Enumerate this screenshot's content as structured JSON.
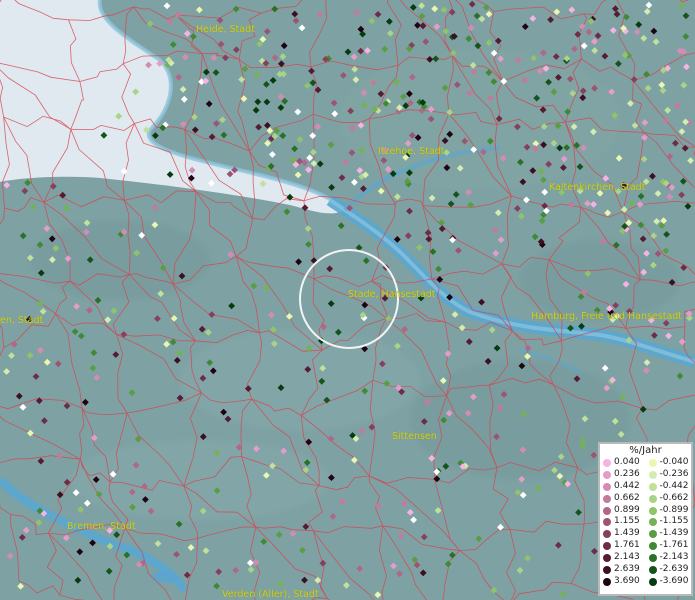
{
  "map": {
    "places": [
      {
        "name": "Heide, Stadt"
      },
      {
        "name": "Itzehoe, Stadt"
      },
      {
        "name": "Kaltenkirchen, Stadt"
      },
      {
        "name": "Stade, Hansestadt"
      },
      {
        "name": "Hamburg, Freie und Hansestadt"
      },
      {
        "name": "en, Stadt"
      },
      {
        "name": "Sittensen"
      },
      {
        "name": "Bremen, Stadt"
      },
      {
        "name": "Verden (Aller), Stadt"
      }
    ]
  },
  "legend": {
    "title": "%/Jahr",
    "rows": [
      {
        "pos": "0.040",
        "neg": "-0.040",
        "pos_color": "#f7b2e4",
        "neg_color": "#e9f7b0"
      },
      {
        "pos": "0.236",
        "neg": "-0.236",
        "pos_color": "#e59ccb",
        "neg_color": "#d3ecb0"
      },
      {
        "pos": "0.442",
        "neg": "-0.442",
        "pos_color": "#d58cb4",
        "neg_color": "#bfe19a"
      },
      {
        "pos": "0.662",
        "neg": "-0.662",
        "pos_color": "#c27a9d",
        "neg_color": "#a9d486"
      },
      {
        "pos": "0.899",
        "neg": "-0.899",
        "pos_color": "#b06888",
        "neg_color": "#8fc46b"
      },
      {
        "pos": "1.155",
        "neg": "-1.155",
        "pos_color": "#9c5473",
        "neg_color": "#74b256"
      },
      {
        "pos": "1.439",
        "neg": "-1.439",
        "pos_color": "#86405d",
        "neg_color": "#5a9e44"
      },
      {
        "pos": "1.761",
        "neg": "-1.761",
        "pos_color": "#6e2c47",
        "neg_color": "#3f8a34"
      },
      {
        "pos": "2.143",
        "neg": "-2.143",
        "pos_color": "#561c33",
        "neg_color": "#2a7026"
      },
      {
        "pos": "2.639",
        "neg": "-2.639",
        "pos_color": "#3c0f21",
        "neg_color": "#15541b"
      },
      {
        "pos": "3.690",
        "neg": "-3.690",
        "pos_color": "#1e0410",
        "neg_color": "#063a0f"
      }
    ]
  }
}
